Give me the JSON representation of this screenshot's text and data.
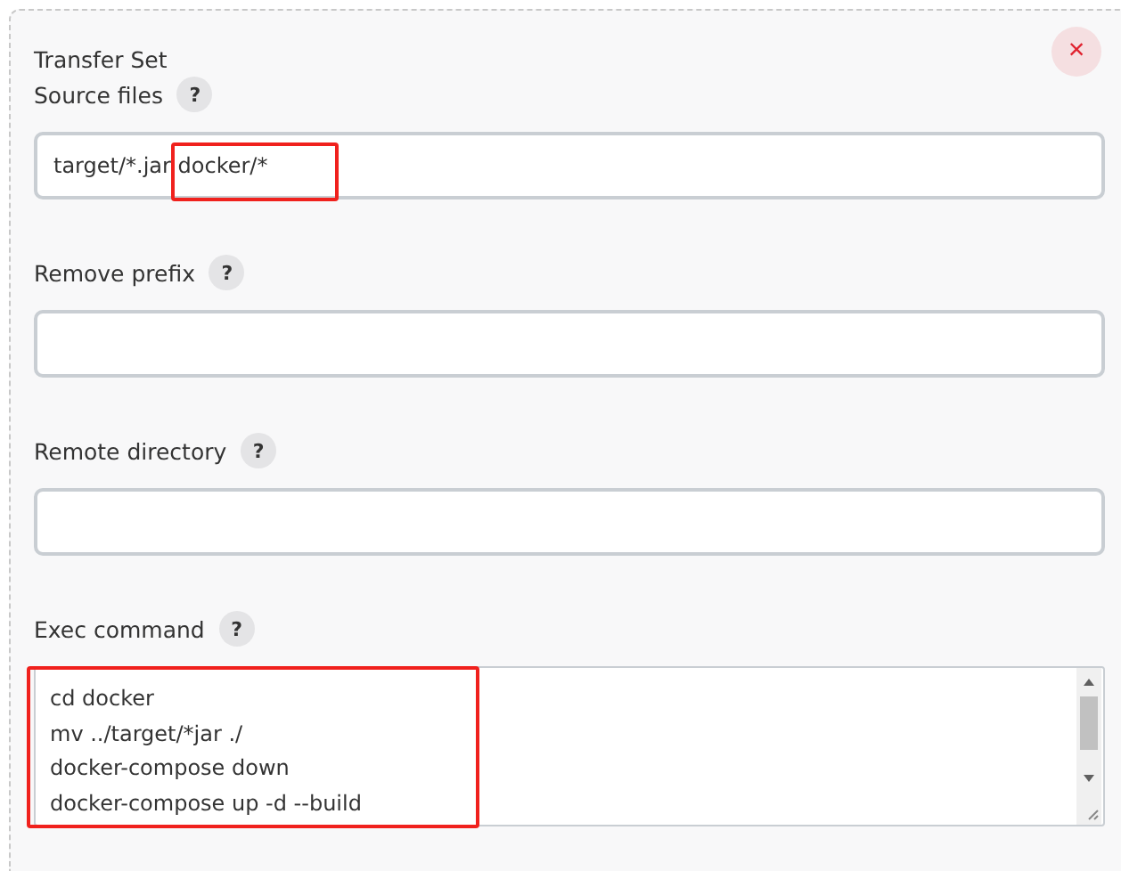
{
  "title": "Transfer Set",
  "fields": [
    {
      "label": "Source files",
      "kind": "input",
      "value": "target/*.jar docker/*",
      "highlighted": true
    },
    {
      "label": "Remove prefix",
      "kind": "input"
    },
    {
      "label": "Remote directory",
      "kind": "input"
    },
    {
      "label": "Exec command",
      "kind": "textarea",
      "lines": [
        "cd docker",
        "mv ../target/*jar ./",
        "docker-compose down",
        "docker-compose up -d --build"
      ],
      "highlighted": true
    }
  ],
  "help_mark": "?",
  "close": "×"
}
